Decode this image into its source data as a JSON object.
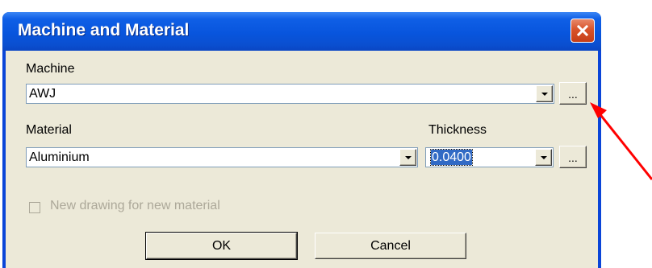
{
  "window": {
    "title": "Machine and Material",
    "close_icon": "close-icon",
    "colors": {
      "titlebar": "#0855dd",
      "client": "#ece9d8",
      "close_button": "#d8532a",
      "selection": "#316ac5",
      "annotation_arrow": "#ff0000"
    }
  },
  "machine": {
    "label": "Machine",
    "value": "AWJ",
    "browse_label": "..."
  },
  "material": {
    "label": "Material",
    "value": "Aluminium"
  },
  "thickness": {
    "label": "Thickness",
    "value": "0.0400",
    "browse_label": "..."
  },
  "options": {
    "new_drawing_label": "New drawing for new material",
    "new_drawing_checked": false,
    "new_drawing_enabled": false
  },
  "buttons": {
    "ok_label": "OK",
    "cancel_label": "Cancel"
  }
}
